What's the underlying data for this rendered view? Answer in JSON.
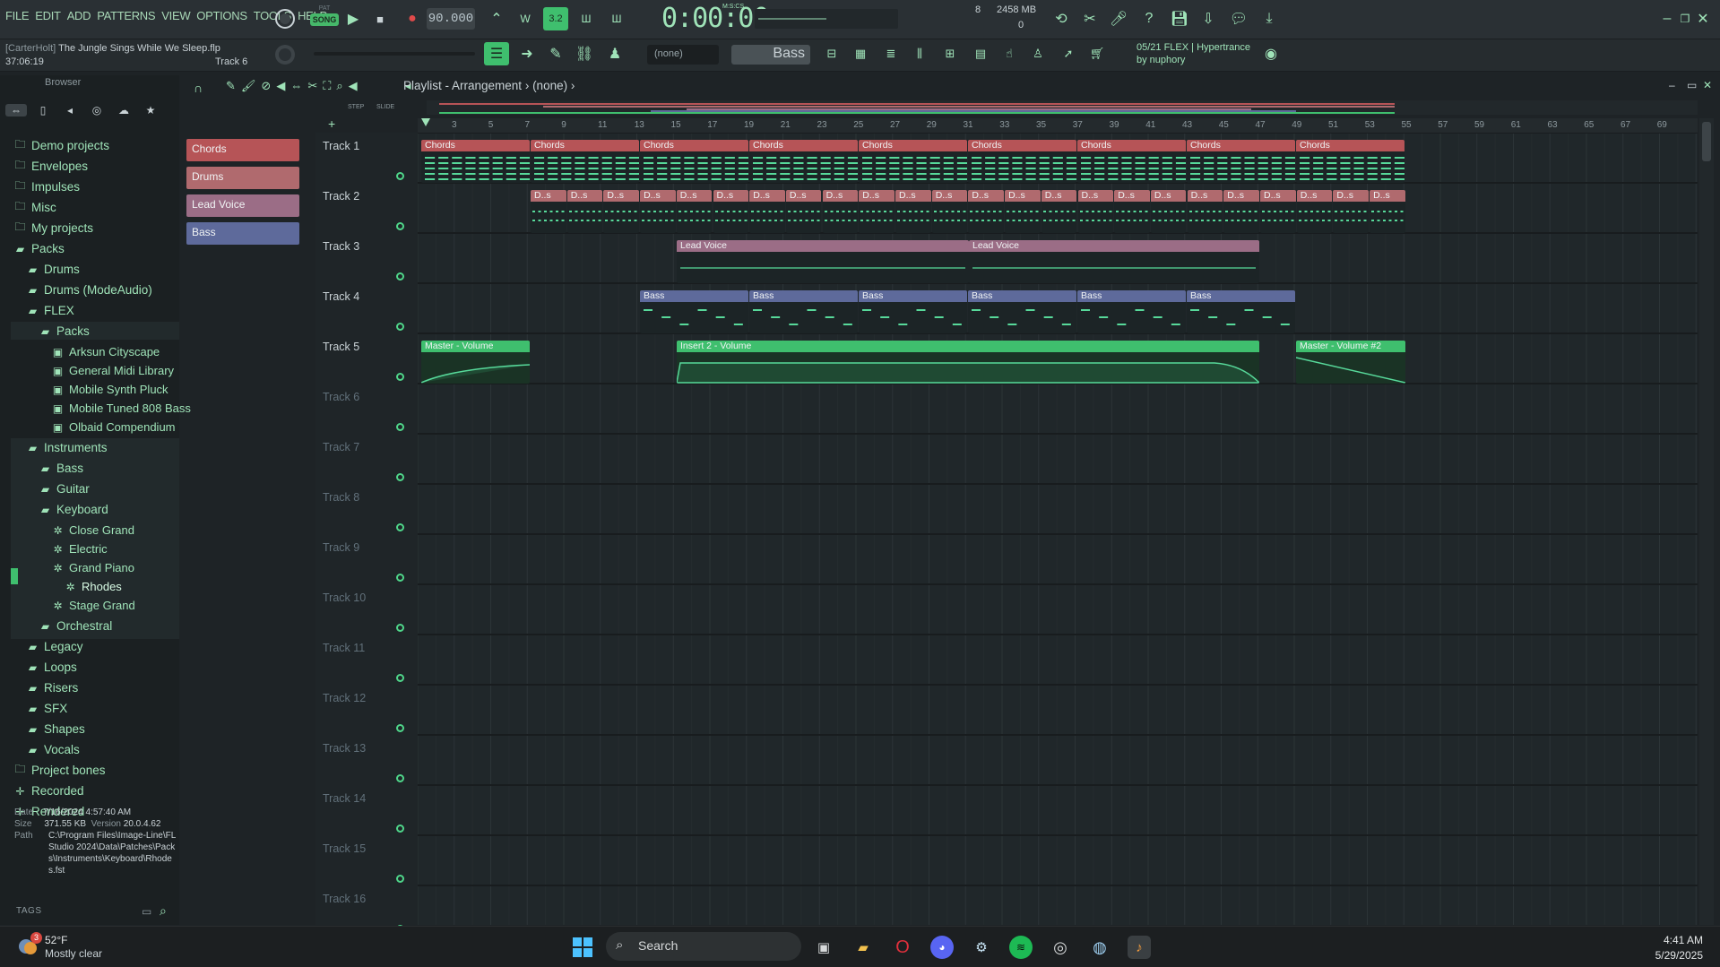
{
  "menu": [
    "FILE",
    "EDIT",
    "ADD",
    "PATTERNS",
    "VIEW",
    "OPTIONS",
    "TOOLS",
    "HELP"
  ],
  "transport": {
    "pat_label": "PAT",
    "song_label": "SONG",
    "tempo": "90.000",
    "timecode": "0:00:00",
    "timecode_format": "M:S:CS",
    "cpu": "8",
    "memory": "2458 MB",
    "polyphony": "0"
  },
  "project": {
    "author": "[CarterHolt]",
    "title": "The Jungle Sings While We Sleep.flp",
    "time": "37:06:19",
    "track": "Track 6"
  },
  "toolbar2": {
    "pattern": "(none)",
    "channel": "Bass"
  },
  "hint": {
    "line1": "05/21  FLEX | Hypertrance",
    "line2": "by nuphory"
  },
  "browser": {
    "title": "Browser",
    "items": [
      {
        "label": "Demo projects"
      },
      {
        "label": "Envelopes"
      },
      {
        "label": "Impulses"
      },
      {
        "label": "Misc"
      },
      {
        "label": "My projects"
      },
      {
        "label": "Packs"
      },
      {
        "label": "Drums"
      },
      {
        "label": "Drums (ModeAudio)"
      },
      {
        "label": "FLEX"
      },
      {
        "label": "Packs"
      },
      {
        "label": "Arksun Cityscape"
      },
      {
        "label": "General Midi Library"
      },
      {
        "label": "Mobile Synth Pluck"
      },
      {
        "label": "Mobile Tuned 808 Bass"
      },
      {
        "label": "Olbaid Compendium"
      },
      {
        "label": "Instruments"
      },
      {
        "label": "Bass"
      },
      {
        "label": "Guitar"
      },
      {
        "label": "Keyboard"
      },
      {
        "label": "Close Grand"
      },
      {
        "label": "Electric"
      },
      {
        "label": "Grand Piano"
      },
      {
        "label": "Rhodes"
      },
      {
        "label": "Stage Grand"
      },
      {
        "label": "Orchestral"
      },
      {
        "label": "Legacy"
      },
      {
        "label": "Loops"
      },
      {
        "label": "Risers"
      },
      {
        "label": "SFX"
      },
      {
        "label": "Shapes"
      },
      {
        "label": "Vocals"
      },
      {
        "label": "Project bones"
      },
      {
        "label": "Recorded"
      },
      {
        "label": "Rendered"
      }
    ],
    "info": {
      "date_label": "Date",
      "date": "7/16/2024 4:57:40 AM",
      "size_label": "Size",
      "size": "371.55 KB",
      "version_label": "Version",
      "version": "20.0.4.62",
      "path_label": "Path",
      "path": "C:\\Program Files\\Image-Line\\FL Studio 2024\\Data\\Patches\\Packs\\Instruments\\Keyboard\\Rhodes.fst"
    },
    "tags_label": "TAGS"
  },
  "patterns": [
    {
      "label": "Chords",
      "color": "#b65457"
    },
    {
      "label": "Drums",
      "color": "#b06a6e"
    },
    {
      "label": "Lead Voice",
      "color": "#9b6d86"
    },
    {
      "label": "Bass",
      "color": "#5e6a9b"
    }
  ],
  "playlist": {
    "title": "Playlist - Arrangement",
    "pattern": "(none)",
    "step_label": "STEP",
    "slide_label": "SLIDE",
    "ruler": [
      "3",
      "5",
      "7",
      "9",
      "11",
      "13",
      "15",
      "17",
      "19",
      "21",
      "23",
      "25",
      "27",
      "29",
      "31",
      "33",
      "35",
      "37",
      "39",
      "41",
      "43",
      "45",
      "47",
      "49",
      "51",
      "53",
      "55",
      "57",
      "59",
      "61",
      "63",
      "65",
      "67",
      "69"
    ],
    "tracks": [
      "Track 1",
      "Track 2",
      "Track 3",
      "Track 4",
      "Track 5",
      "Track 6",
      "Track 7",
      "Track 8",
      "Track 9",
      "Track 10",
      "Track 11",
      "Track 12",
      "Track 13",
      "Track 14",
      "Track 15",
      "Track 16"
    ],
    "clips": {
      "chords": "Chords",
      "drums": "D..s",
      "lead": "Lead Voice",
      "bass": "Bass",
      "auto1": "Master - Volume",
      "auto2": "Insert 2 - Volume",
      "auto3": "Master - Volume #2"
    }
  },
  "taskbar": {
    "weather_temp": "52°F",
    "weather_desc": "Mostly clear",
    "weather_badge": "3",
    "search": "Search",
    "time": "4:41 AM",
    "date": "5/29/2025"
  },
  "colors": {
    "accent": "#4fd68a",
    "chords": "#b65457",
    "drums": "#b06a6e",
    "lead": "#9b6d86",
    "bass": "#5e6a9b",
    "automation": "#3fbf6e"
  }
}
